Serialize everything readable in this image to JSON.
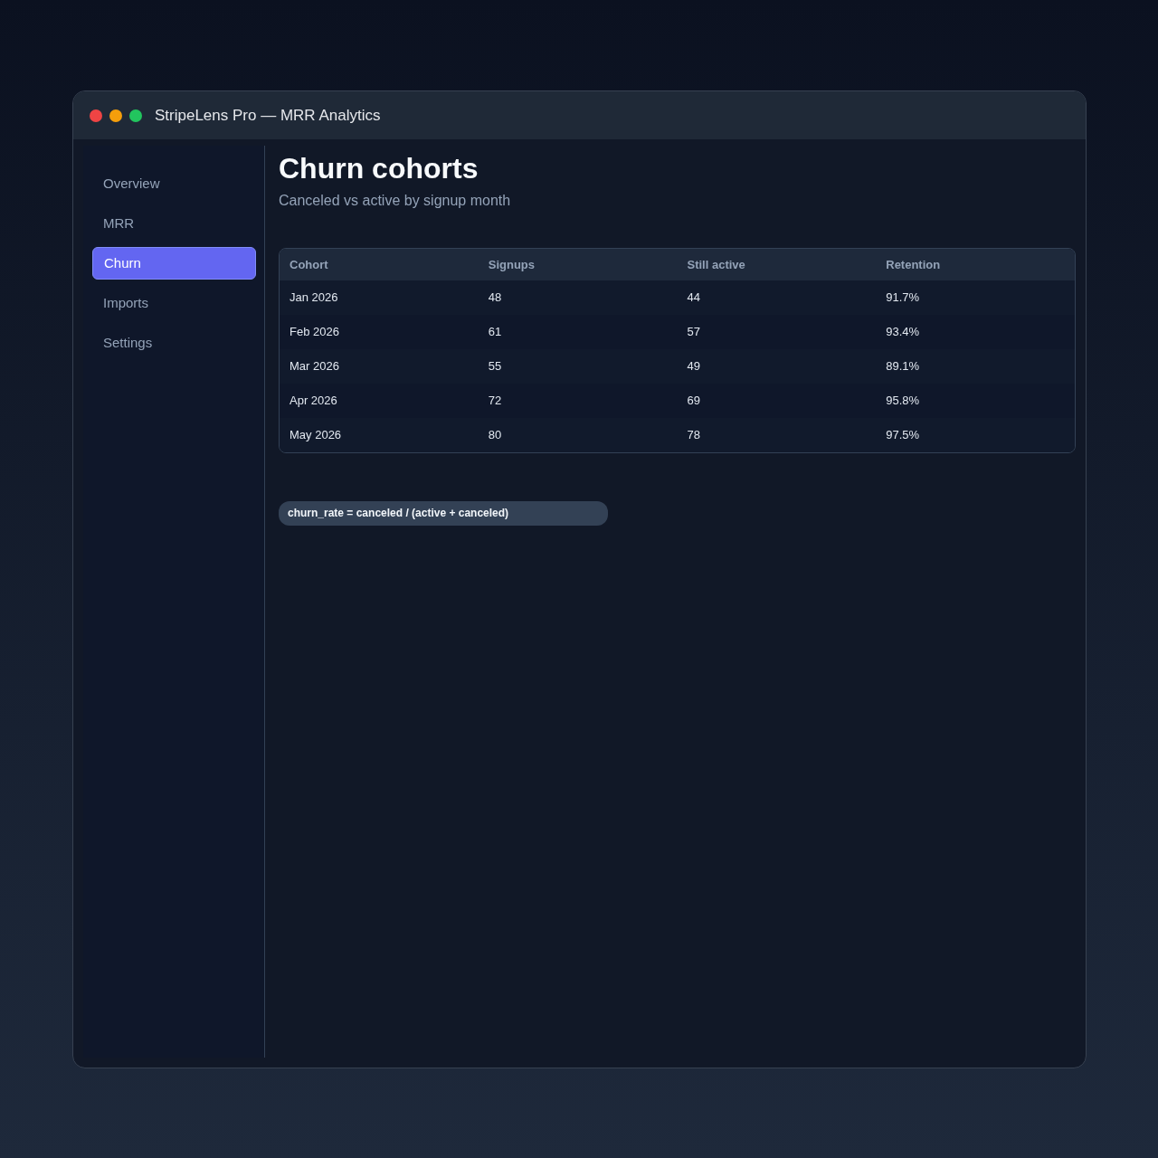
{
  "window": {
    "title": "StripeLens Pro — MRR Analytics"
  },
  "sidebar": {
    "items": [
      {
        "label": "Overview",
        "selected": false
      },
      {
        "label": "MRR",
        "selected": false
      },
      {
        "label": "Churn",
        "selected": true
      },
      {
        "label": "Imports",
        "selected": false
      },
      {
        "label": "Settings",
        "selected": false
      }
    ]
  },
  "header": {
    "title": "Churn cohorts",
    "subtitle": "Canceled vs active by signup month"
  },
  "table": {
    "columns": [
      "Cohort",
      "Signups",
      "Still active",
      "Retention"
    ],
    "rows": [
      [
        "Jan 2026",
        "48",
        "44",
        "91.7%"
      ],
      [
        "Feb 2026",
        "61",
        "57",
        "93.4%"
      ],
      [
        "Mar 2026",
        "55",
        "49",
        "89.1%"
      ],
      [
        "Apr 2026",
        "72",
        "69",
        "95.8%"
      ],
      [
        "May 2026",
        "80",
        "78",
        "97.5%"
      ]
    ]
  },
  "formula": "churn_rate = canceled / (active + canceled)"
}
